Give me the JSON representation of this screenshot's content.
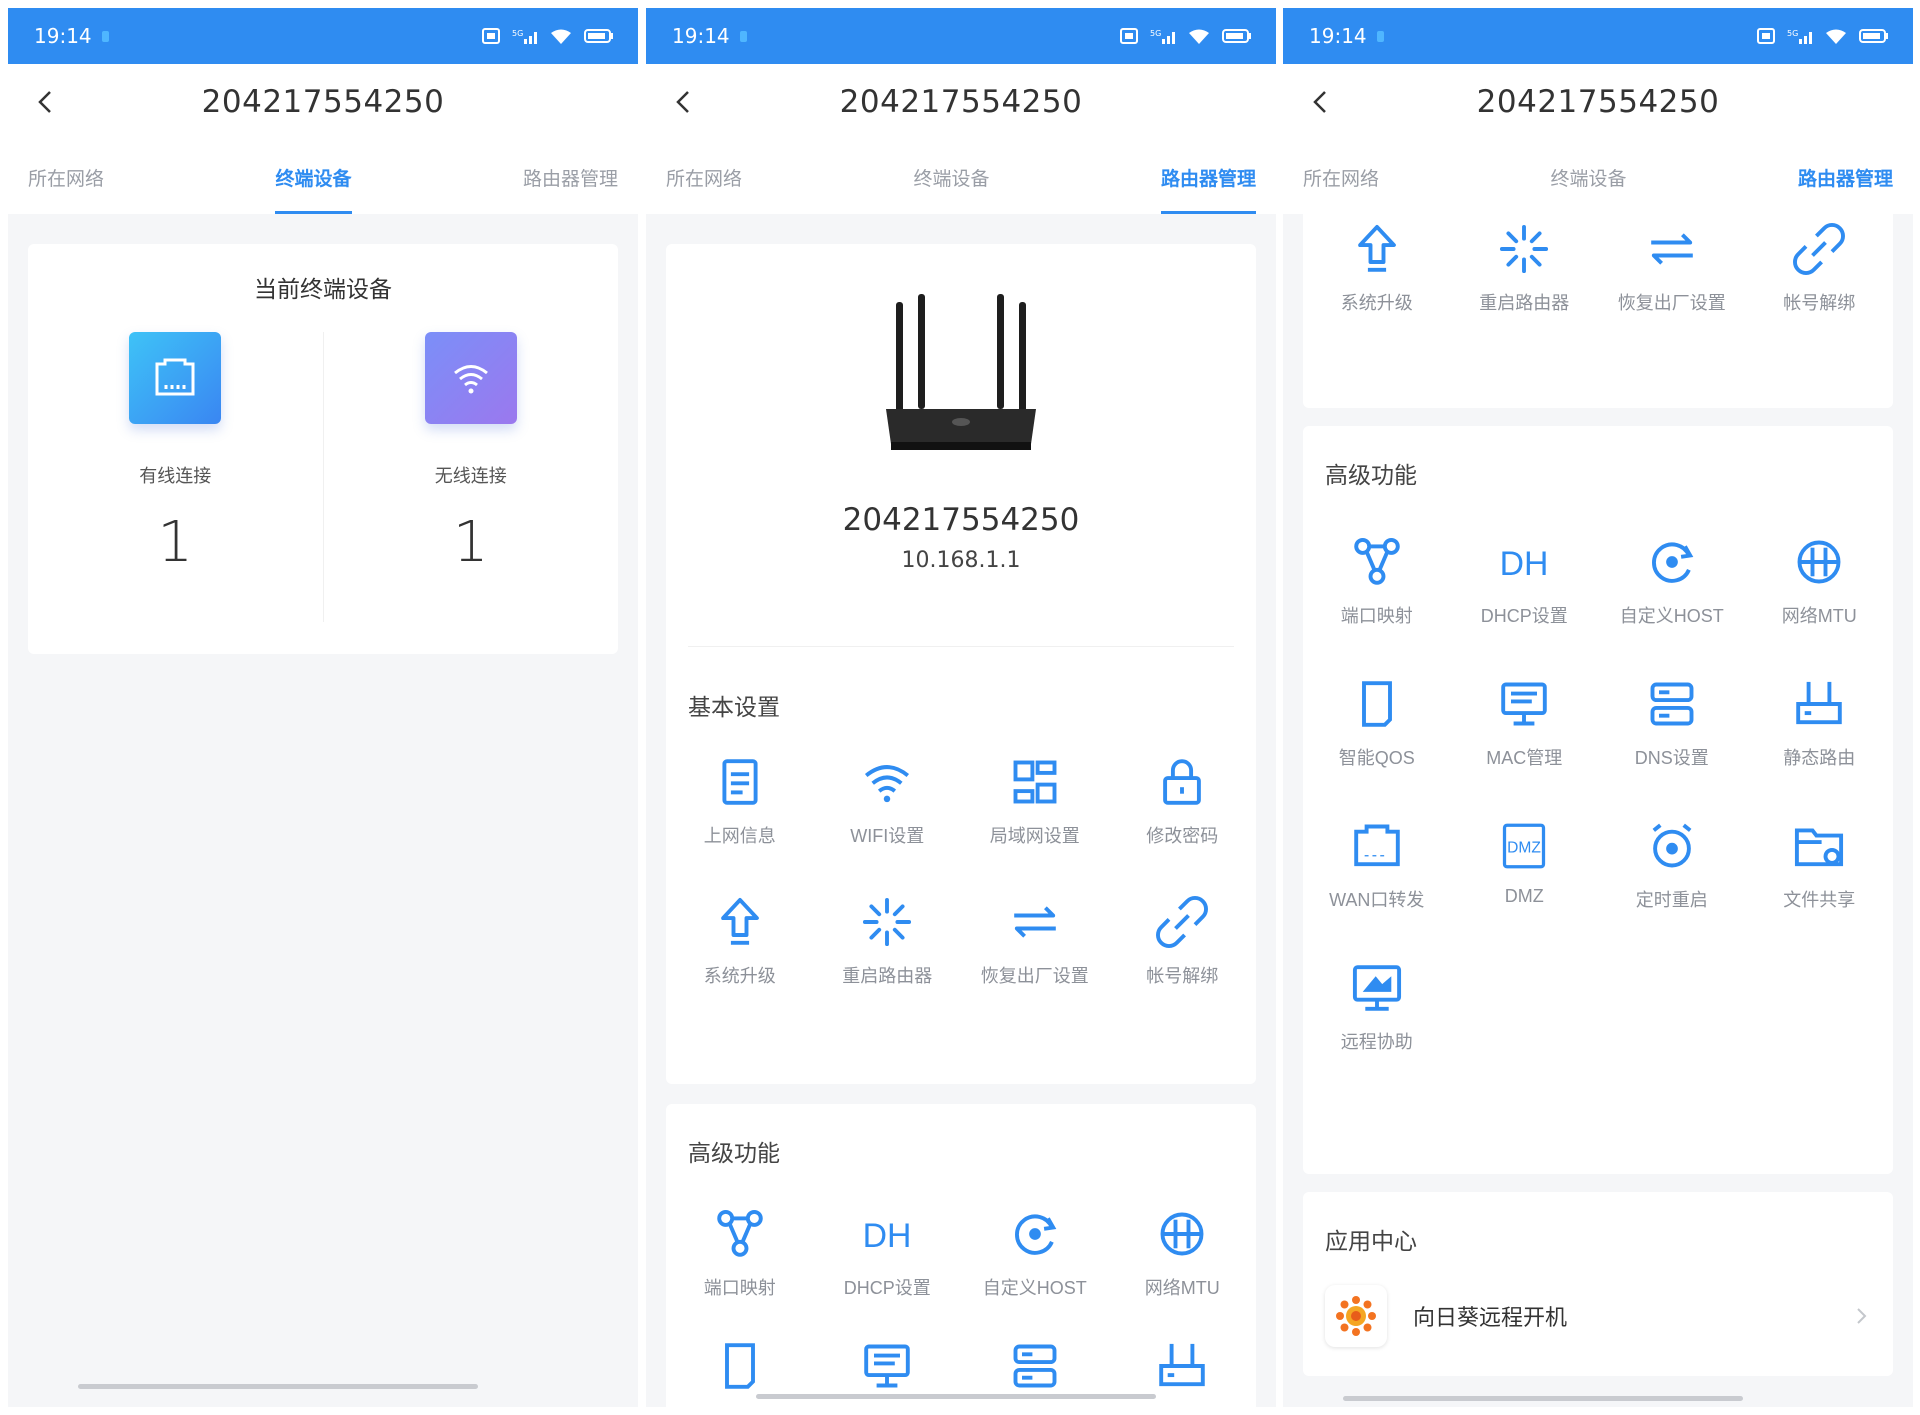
{
  "status": {
    "time": "19:14"
  },
  "device_title": "204217554250",
  "tabs": [
    "所在网络",
    "终端设备",
    "路由器管理"
  ],
  "screen1": {
    "card_title": "当前终端设备",
    "wired": {
      "label": "有线连接",
      "count": "1"
    },
    "wireless": {
      "label": "无线连接",
      "count": "1"
    }
  },
  "screen2": {
    "device_name": "204217554250",
    "ip": "10.168.1.1",
    "basic_title": "基本设置",
    "basic_items": [
      {
        "label": "上网信息",
        "icon": "document-icon"
      },
      {
        "label": "WIFI设置",
        "icon": "wifi-icon"
      },
      {
        "label": "局域网设置",
        "icon": "lan-icon"
      },
      {
        "label": "修改密码",
        "icon": "lock-icon"
      },
      {
        "label": "系统升级",
        "icon": "upgrade-icon"
      },
      {
        "label": "重启路由器",
        "icon": "restart-icon"
      },
      {
        "label": "恢复出厂设置",
        "icon": "reset-icon"
      },
      {
        "label": "帐号解绑",
        "icon": "unlink-icon"
      }
    ],
    "advanced_title": "高级功能",
    "advanced_items": [
      {
        "label": "端口映射",
        "icon": "port-mapping-icon"
      },
      {
        "label": "DHCP设置",
        "icon": "dhcp-icon"
      },
      {
        "label": "自定义HOST",
        "icon": "host-icon"
      },
      {
        "label": "网络MTU",
        "icon": "mtu-icon"
      }
    ]
  },
  "screen3": {
    "top_items": [
      {
        "label": "系统升级",
        "icon": "upgrade-icon"
      },
      {
        "label": "重启路由器",
        "icon": "restart-icon"
      },
      {
        "label": "恢复出厂设置",
        "icon": "reset-icon"
      },
      {
        "label": "帐号解绑",
        "icon": "unlink-icon"
      }
    ],
    "advanced_title": "高级功能",
    "advanced_items": [
      {
        "label": "端口映射",
        "icon": "port-mapping-icon"
      },
      {
        "label": "DHCP设置",
        "icon": "dhcp-icon"
      },
      {
        "label": "自定义HOST",
        "icon": "host-icon"
      },
      {
        "label": "网络MTU",
        "icon": "mtu-icon"
      },
      {
        "label": "智能QOS",
        "icon": "qos-icon"
      },
      {
        "label": "MAC管理",
        "icon": "mac-icon"
      },
      {
        "label": "DNS设置",
        "icon": "dns-icon"
      },
      {
        "label": "静态路由",
        "icon": "static-route-icon"
      },
      {
        "label": "WAN口转发",
        "icon": "wan-forward-icon"
      },
      {
        "label": "DMZ",
        "icon": "dmz-icon"
      },
      {
        "label": "定时重启",
        "icon": "timer-restart-icon"
      },
      {
        "label": "文件共享",
        "icon": "file-share-icon"
      },
      {
        "label": "远程协助",
        "icon": "remote-assist-icon"
      }
    ],
    "app_center_title": "应用中心",
    "app_name": "向日葵远程开机"
  },
  "colors": {
    "accent": "#2f8cf1",
    "status_bar": "#2f8cf1",
    "label_gray": "#8d9199"
  }
}
